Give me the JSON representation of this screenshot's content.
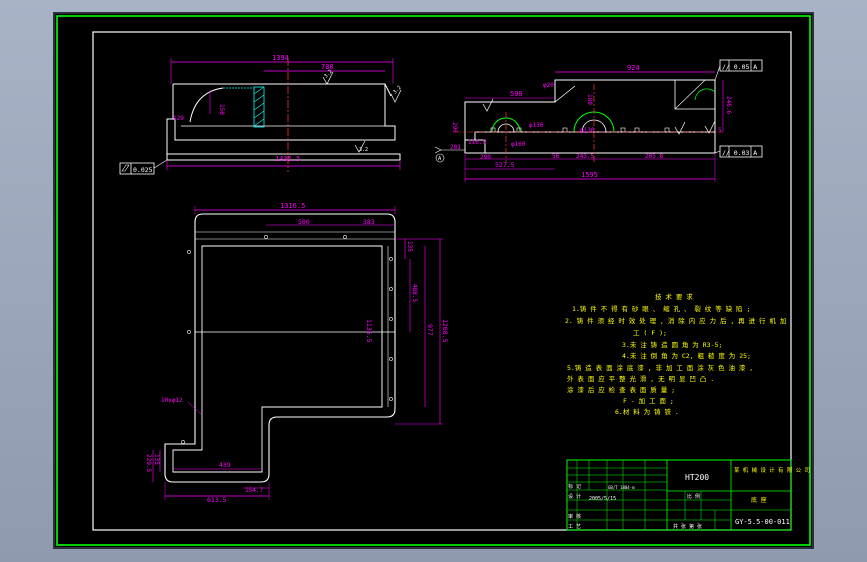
{
  "colors": {
    "background": "#000000",
    "outer_border": "#00ff00",
    "inner_border": "#ffffff",
    "part_outline": "#ffffff",
    "dimension": "#ff00ff",
    "centerline": "#ff3333",
    "hatch": "#00ffff",
    "notes": "#ffff00",
    "title_block": "#00ff00"
  },
  "front_view": {
    "dims": {
      "overall_top": "1394",
      "upper_inner": "788",
      "left_radius": "150",
      "left_step": "129",
      "bottom_overall": "1435.5"
    },
    "symbols": {
      "roughness_top": "3.2",
      "roughness_right": "3.2",
      "roughness_bottom": "3.2",
      "flatness_tol": "0.025"
    }
  },
  "side_view": {
    "dims": {
      "top_width": "924",
      "offset_590": "590",
      "phi_20": "φ20",
      "height_180": "180",
      "height_246": "246.6",
      "height_296": "296",
      "height_116": "116.5",
      "phi_130_a": "φ130",
      "phi_130_b": "φ130",
      "phi_160": "φ160",
      "dim_281": "281",
      "dim_290": "290",
      "dim_56": "56",
      "dim_243": "243.5",
      "dim_205": "205.8",
      "dim_527": "527.5",
      "dim_1595": "1595",
      "dim_5": "5"
    },
    "tolerances": {
      "parallel_top": "// 0.05 A",
      "parallel_bottom": "// 0.03 A",
      "datum_label": "A"
    }
  },
  "plan_view": {
    "dims": {
      "top_overall": "1316.5",
      "top_500": "500",
      "top_383": "383",
      "right_135": "135",
      "right_488": "488.5",
      "right_977": "977",
      "right_1208": "1208.5",
      "inner_1135": "1135.5",
      "hole_note": "10xφ12",
      "left_229": "229.5",
      "left_135": "135",
      "bottom_439": "439",
      "bottom_154": "154.7",
      "bottom_613": "613.5"
    }
  },
  "notes": {
    "title": "技 术 要 求",
    "lines": [
      "1.铸 件 不 得 有 砂 眼 、 缩 孔 、 裂 纹 等 缺 陷 ;",
      "2. 铸 件 须 经 时 效 处 理 , 消 除 内 应 力 后 , 再 进 行 机 加",
      "   工 ( F );",
      "3.未 注 铸 造 圆 角 为 R3-5;",
      "4.未 注 倒 角 为 C2, 粗 糙 度 为 25;",
      "5.铸 造 表 面 涂 底 漆 , 非 加 工 面 涂 灰 色 油 漆 ,",
      "   外 表 面 应 平 整 光 滑 , 无 明 显 凹 凸 .",
      "   涂 漆 后 应 检 查 表 面 质 量 ;",
      "   F - 加 工 面 ;",
      "6.材 料 为 铸 铁 ."
    ]
  },
  "title_block": {
    "material": "HT200",
    "company": "某 机 械 设 计 有 限 公 司",
    "part_name": "底 座",
    "drawing_no": "GY-5.5-00-011",
    "scale_label": "比 例",
    "sheet_label": "共 张 第 张",
    "rows_left": [
      "标 记",
      "设 计",
      "审 核",
      "工 艺"
    ],
    "stamp": "GB/T 1804-m",
    "signature": "2005/5/15"
  }
}
